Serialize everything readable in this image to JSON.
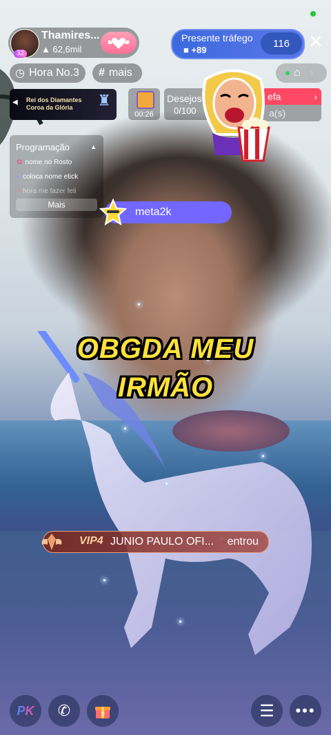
{
  "host": {
    "name": "Thamires...",
    "level": "32",
    "followers": "62,6mil"
  },
  "gift_traffic": {
    "title": "Presente tráfego",
    "bonus": "+89",
    "count": "116"
  },
  "tags": {
    "hour": "Hora No.3",
    "more": "mais"
  },
  "banner": {
    "line1": "Rei dos Diamantes",
    "line2": "Coroa da Glória"
  },
  "timer": "00:26",
  "wishes": {
    "label": "Desejos",
    "progress": "0/100"
  },
  "task": {
    "label": "efa",
    "sub": "a(s)"
  },
  "schedule": {
    "title": "Programação",
    "items": [
      "nome no Rosto",
      "coloca nome etick",
      "hora me fazer feli"
    ],
    "more": "Mais"
  },
  "notification": {
    "user": "meta2k"
  },
  "caption": {
    "line1": "OBGDA MEU",
    "line2": "IRMÃO"
  },
  "entry": {
    "vip": "VIP4",
    "user": "JUNIO PAULO OFI...",
    "action": "entrou"
  },
  "bottom": {
    "pk": "PK"
  }
}
